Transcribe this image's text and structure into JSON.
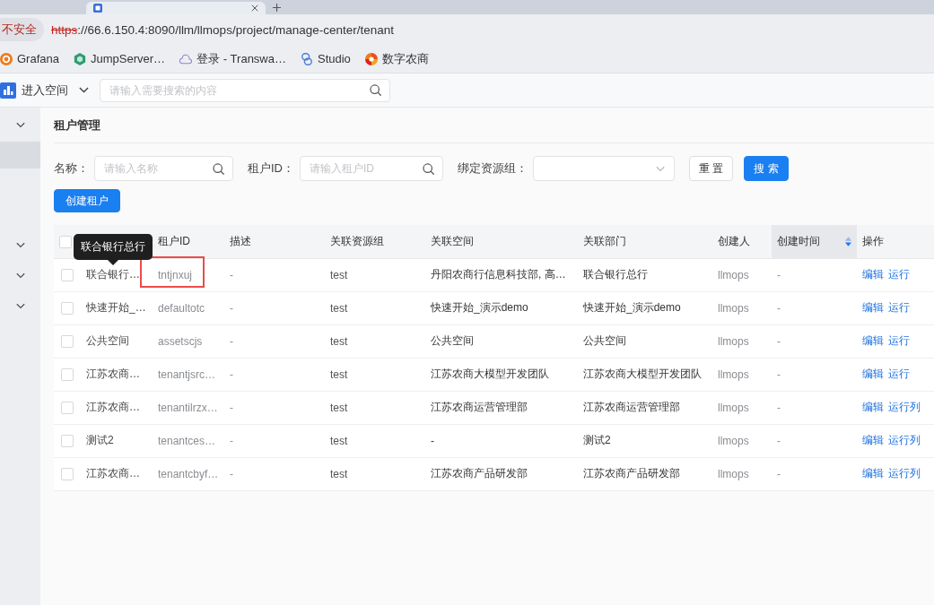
{
  "browser": {
    "security_label": "不安全",
    "url": {
      "scheme": "https",
      "rest": "://66.6.150.4:8090/llm/llmops/project/manage-center/tenant"
    },
    "bookmarks": [
      "Grafana",
      "JumpServer…",
      "登录 - Transwa…",
      "Studio",
      "数字农商"
    ]
  },
  "app_header": {
    "space_selector": "进入空间",
    "search": {
      "placeholder": "请输入需要搜索的内容"
    }
  },
  "sidebar": {
    "items": [
      {
        "kind": "group"
      },
      {
        "kind": "item",
        "selected": true
      },
      {
        "kind": "group"
      },
      {
        "kind": "group"
      },
      {
        "kind": "group"
      }
    ]
  },
  "page_title": "租户管理",
  "filters": [
    {
      "kind": "search",
      "label": "名称：",
      "placeholder": "请输入名称"
    },
    {
      "kind": "search",
      "label": "租户ID：",
      "placeholder": "请输入租户ID"
    },
    {
      "kind": "select",
      "label": "绑定资源组："
    }
  ],
  "filter_buttons": [
    {
      "kind": "reset",
      "label": "重 置"
    },
    {
      "kind": "search",
      "label": "搜 索"
    }
  ],
  "create_button": "创建租户",
  "table": {
    "all_checked": false,
    "columns": [
      {
        "label": "租户ID",
        "sortable": false
      },
      {
        "label": "描述",
        "sortable": false
      },
      {
        "label": "关联资源组",
        "sortable": false
      },
      {
        "label": "关联空间",
        "sortable": false
      },
      {
        "label": "关联部门",
        "sortable": false
      },
      {
        "label": "创建人",
        "sortable": false
      },
      {
        "label": "创建时间",
        "sortable": true
      },
      {
        "label": "操作",
        "sortable": false
      }
    ],
    "rows": [
      {
        "checked": false,
        "column_1": "联合银行…",
        "tooltip": "联合银行总行",
        "tenant_id": "tntjnxuj",
        "marked": true,
        "description": "-",
        "resource_group": "test",
        "space": "丹阳农商行信息科技部, 高…",
        "department": "联合银行总行",
        "creator": "llmops",
        "created_time": "-",
        "actions": [
          "编辑",
          "运行"
        ]
      },
      {
        "checked": false,
        "column_1": "快速开始_…",
        "tenant_id": "defaultotc",
        "marked": false,
        "description": "-",
        "resource_group": "test",
        "space": "快速开始_演示demo",
        "department": "快速开始_演示demo",
        "creator": "llmops",
        "created_time": "-",
        "actions": [
          "编辑",
          "运行"
        ]
      },
      {
        "checked": false,
        "column_1": "公共空间",
        "tenant_id": "assetscjs",
        "marked": false,
        "description": "-",
        "resource_group": "test",
        "space": "公共空间",
        "department": "公共空间",
        "creator": "llmops",
        "created_time": "-",
        "actions": [
          "编辑",
          "运行"
        ]
      },
      {
        "checked": false,
        "column_1": "江苏农商…",
        "tenant_id": "tenantjsrc…",
        "marked": false,
        "description": "-",
        "resource_group": "test",
        "space": "江苏农商大模型开发团队",
        "department": "江苏农商大模型开发团队",
        "creator": "llmops",
        "created_time": "-",
        "actions": [
          "编辑",
          "运行"
        ]
      },
      {
        "checked": false,
        "column_1": "江苏农商…",
        "tenant_id": "tenantilrzx…",
        "marked": false,
        "description": "-",
        "resource_group": "test",
        "space": "江苏农商运营管理部",
        "department": "江苏农商运营管理部",
        "creator": "llmops",
        "created_time": "-",
        "actions": [
          "编辑",
          "运行列"
        ]
      },
      {
        "checked": false,
        "column_1": "测试2",
        "tenant_id": "tenantces…",
        "marked": false,
        "description": "-",
        "resource_group": "test",
        "space": "-",
        "department": "测试2",
        "creator": "llmops",
        "created_time": "-",
        "actions": [
          "编辑",
          "运行列"
        ]
      },
      {
        "checked": false,
        "column_1": "江苏农商…",
        "tenant_id": "tenantcbyf…",
        "marked": false,
        "description": "-",
        "resource_group": "test",
        "space": "江苏农商产品研发部",
        "department": "江苏农商产品研发部",
        "creator": "llmops",
        "created_time": "-",
        "actions": [
          "编辑",
          "运行列"
        ]
      }
    ]
  }
}
